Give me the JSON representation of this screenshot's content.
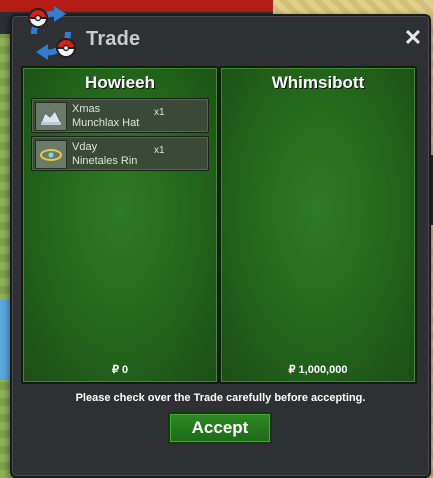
{
  "window": {
    "title": "Trade",
    "close_label": "✕"
  },
  "left_panel": {
    "player_name": "Howieeh",
    "items": [
      {
        "line1": "Xmas",
        "line2": "Munchlax Hat",
        "qty": "x1",
        "icon": "munchlax-hat-icon"
      },
      {
        "line1": "Vday",
        "line2": "Ninetales Rin",
        "qty": "x1",
        "icon": "ninetales-ring-icon"
      }
    ],
    "money_symbol": "₽",
    "money": "0"
  },
  "right_panel": {
    "player_name": "Whimsibott",
    "items": [],
    "money_symbol": "₽",
    "money": "1,000,000"
  },
  "notice": "Please check over the Trade carefully before accepting.",
  "accept_label": "Accept",
  "colors": {
    "panel_green": "#246a1c",
    "window_bg": "#2f3033",
    "title_gray": "#c9cbcf",
    "accept_green": "#2c8a22"
  }
}
